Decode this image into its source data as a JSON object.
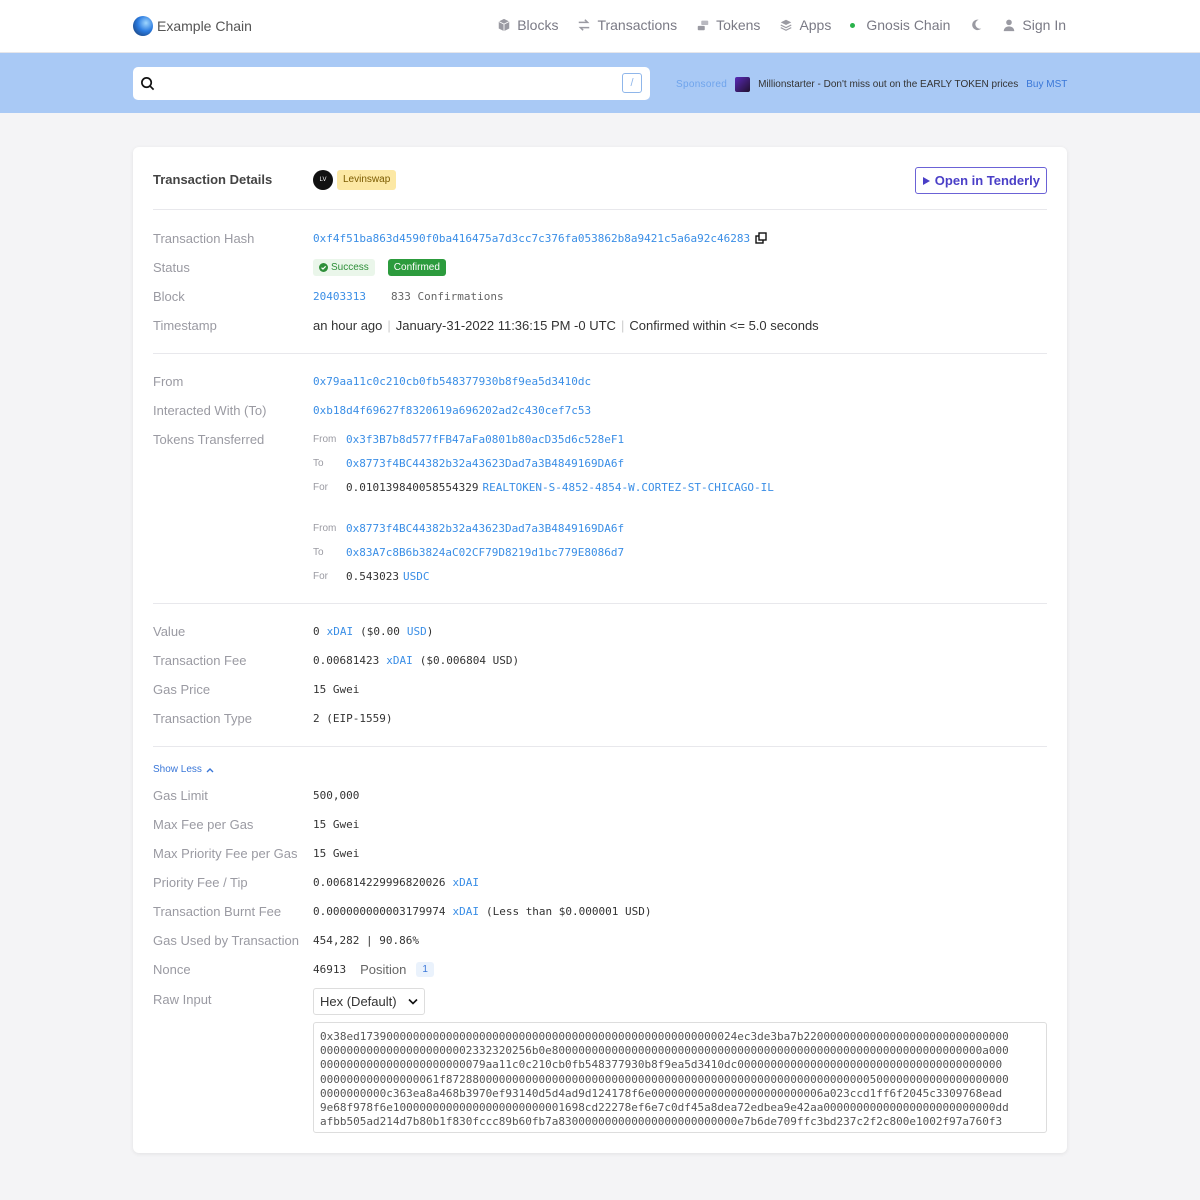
{
  "nav": {
    "brand": "Example Chain",
    "items": [
      "Blocks",
      "Transactions",
      "Tokens",
      "Apps"
    ],
    "network": "Gnosis Chain",
    "sign_in": "Sign In"
  },
  "search": {
    "placeholder": "",
    "shortcut": "/"
  },
  "sponsor": {
    "tag": "Sponsored",
    "text": "Millionstarter - Don't miss out on the EARLY TOKEN prices",
    "cta": "Buy MST"
  },
  "header": {
    "title": "Transaction Details",
    "protocol_logo_text": "LV",
    "protocol_badge": "Levinswap",
    "tenderly_label": "Open in Tenderly"
  },
  "summary": {
    "hash_label": "Transaction Hash",
    "hash": "0xf4f51ba863d4590f0ba416475a7d3cc7c376fa053862b8a9421c5a6a92c46283",
    "status_label": "Status",
    "status": "Success",
    "confirmed": "Confirmed",
    "block_label": "Block",
    "block": "20403313",
    "confirmations": "833 Confirmations",
    "timestamp_label": "Timestamp",
    "ts_relative": "an hour ago",
    "ts_absolute": "January-31-2022 11:36:15 PM -0 UTC",
    "ts_confirmed": "Confirmed within <= 5.0 seconds"
  },
  "parties": {
    "from_label": "From",
    "from": "0x79aa11c0c210cb0fb548377930b8f9ea5d3410dc",
    "to_label": "Interacted With (To)",
    "to": "0xb18d4f69627f8320619a696202ad2c430cef7c53",
    "tokens_label": "Tokens Transferred",
    "sub_from": "From",
    "sub_to": "To",
    "sub_for": "For",
    "transfers": [
      {
        "from": "0x3f3B7b8d577fFB47aFa0801b80acD35d6c528eF1",
        "to": "0x8773f4BC44382b32a43623Dad7a3B4849169DA6f",
        "amount": "0.010139840058554329",
        "token": "REALTOKEN-S-4852-4854-W.CORTEZ-ST-CHICAGO-IL"
      },
      {
        "from": "0x8773f4BC44382b32a43623Dad7a3B4849169DA6f",
        "to": "0x83A7c8B6b3824aC02CF79D8219d1bc779E8086d7",
        "amount": "0.543023",
        "token": "USDC"
      }
    ]
  },
  "fees": {
    "value_label": "Value",
    "value_amount": "0",
    "value_token": "xDAI",
    "value_usd": "($0.00",
    "value_usd_unit": "USD",
    "value_usd_close": ")",
    "fee_label": "Transaction Fee",
    "fee_amount": "0.00681423",
    "fee_token": "xDAI",
    "fee_usd": "($0.006804 USD)",
    "gas_price_label": "Gas Price",
    "gas_price": "15 Gwei",
    "type_label": "Transaction Type",
    "type": "2 (EIP-1559)"
  },
  "more": {
    "toggle": "Show Less",
    "gas_limit_label": "Gas Limit",
    "gas_limit": "500,000",
    "max_fee_label": "Max Fee per Gas",
    "max_fee": "15 Gwei",
    "max_priority_label": "Max Priority Fee per Gas",
    "max_priority": "15 Gwei",
    "priority_tip_label": "Priority Fee / Tip",
    "priority_tip": "0.006814229996820026",
    "priority_tip_token": "xDAI",
    "burnt_label": "Transaction Burnt Fee",
    "burnt": "0.000000000003179974",
    "burnt_token": "xDAI",
    "burnt_note": "(Less than $0.000001 USD)",
    "gas_used_label": "Gas Used by Transaction",
    "gas_used": "454,282 | 90.86%",
    "nonce_label": "Nonce",
    "nonce": "46913",
    "position_label": "Position",
    "position": "1",
    "raw_label": "Raw Input",
    "raw_format": "Hex (Default)",
    "raw_lines": [
      "0x38ed173900000000000000000000000000000000000000000000000000024ec3de3ba7b2200000000000000000000000000000",
      "00000000000000000000002332320256b0e80000000000000000000000000000000000000000000000000000000000000000a000",
      "0000000000000000000000079aa11c0c210cb0fb548377930b8f9ea5d3410dc0000000000000000000000000000000000000000",
      "000000000000000061f8728800000000000000000000000000000000000000000000000000000000000500000000000000000000",
      "0000000000c363ea8a468b3970ef93140d5d4ad9d124178f6e00000000000000000000000006a023ccd1ff6f2045c3309768ead",
      "9e68f978f6e10000000000000000000000001698cd22278ef6e7c0df45a8dea72edbea9e42aa00000000000000000000000000dd",
      "afbb505ad214d7b80b1f830fccc89b60fb7a830000000000000000000000000e7b6de709ffc3bd237c2f2c800e1002f97a760f3"
    ]
  },
  "colors": {
    "band": "#a9c9f5",
    "link": "#3a8ee6",
    "success": "#2c9b3d",
    "badge": "#fce8a4"
  }
}
